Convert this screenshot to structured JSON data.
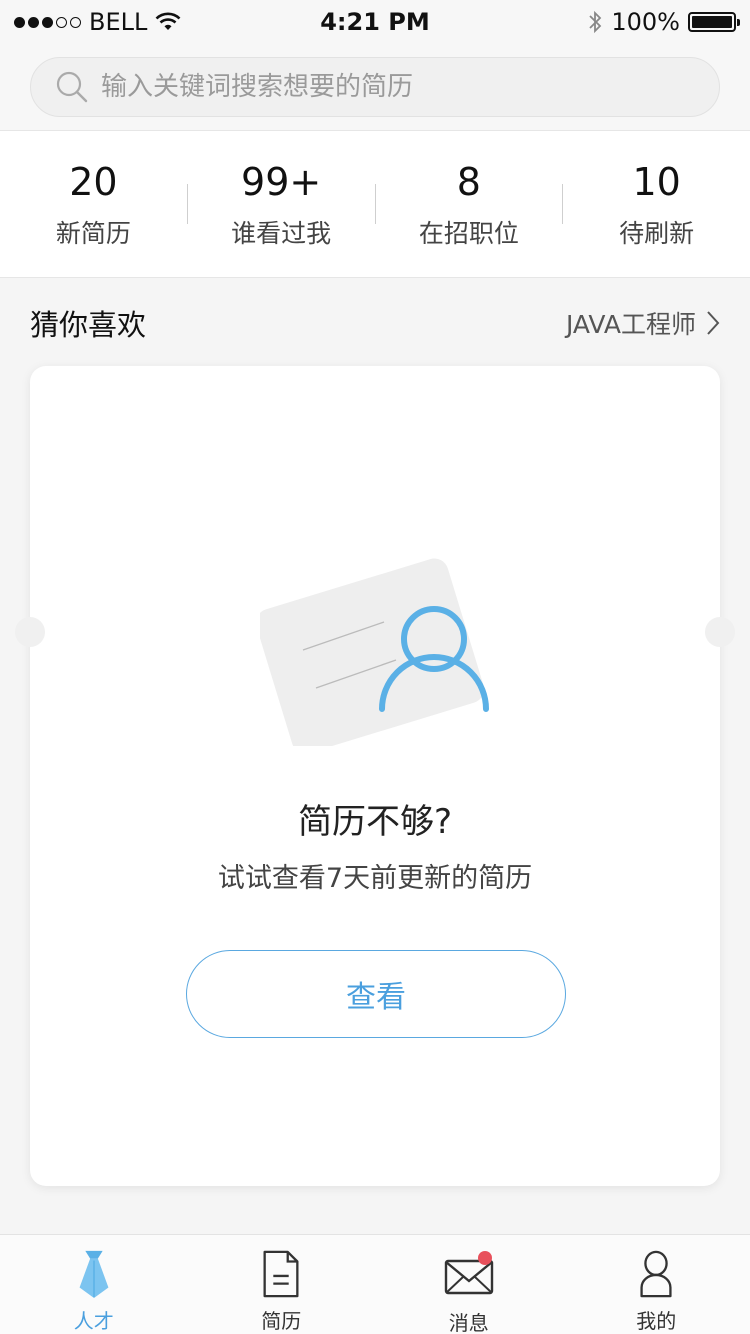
{
  "status_bar": {
    "carrier": "BELL",
    "time": "4:21 PM",
    "battery": "100%",
    "battery_level": 1.0,
    "signal_filled": 3,
    "signal_total": 5
  },
  "search": {
    "placeholder": "输入关键词搜索想要的简历",
    "value": ""
  },
  "stats": [
    {
      "value": "20",
      "label": "新简历"
    },
    {
      "value": "99+",
      "label": "谁看过我"
    },
    {
      "value": "8",
      "label": "在招职位"
    },
    {
      "value": "10",
      "label": "待刷新"
    }
  ],
  "section": {
    "title": "猜你喜欢",
    "filter": "JAVA工程师"
  },
  "card": {
    "title": "简历不够?",
    "subtitle": "试试查看7天前更新的简历",
    "button": "查看"
  },
  "nav": [
    {
      "label": "人才",
      "icon": "tie-icon",
      "active": true
    },
    {
      "label": "简历",
      "icon": "document-icon",
      "active": false
    },
    {
      "label": "消息",
      "icon": "mail-icon",
      "active": false,
      "badge": true
    },
    {
      "label": "我的",
      "icon": "person-icon",
      "active": false
    }
  ],
  "colors": {
    "accent": "#4a9fde",
    "badge": "#e8505b",
    "illustration_blue": "#5ab0e6"
  }
}
